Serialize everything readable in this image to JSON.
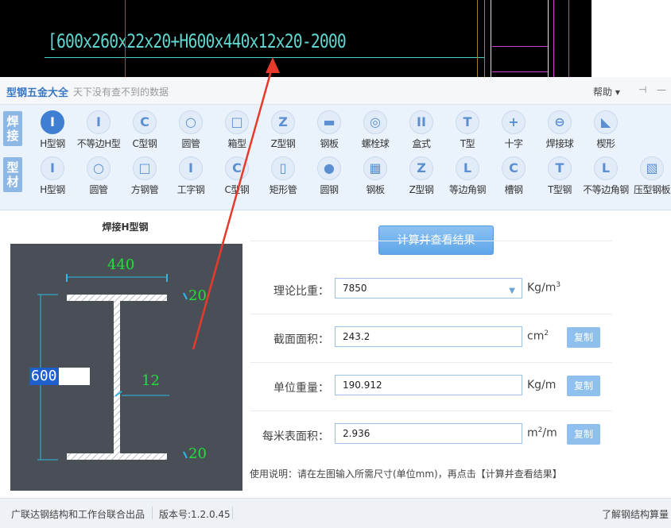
{
  "cad": {
    "text": "[600x260x22x20+H600x440x12x20-2000"
  },
  "app": {
    "title": "型钢五金大全",
    "subtitle": "天下没有查不到的数据",
    "help_label": "帮助 ▾"
  },
  "toolbar": {
    "group1_label": "焊接",
    "group2_label": "型材",
    "row1": [
      {
        "label": "H型钢",
        "icon": "I"
      },
      {
        "label": "不等边H型",
        "icon": "I"
      },
      {
        "label": "C型钢",
        "icon": "C"
      },
      {
        "label": "圆管",
        "icon": "○"
      },
      {
        "label": "箱型",
        "icon": "□"
      },
      {
        "label": "Z型钢",
        "icon": "Z"
      },
      {
        "label": "钢板",
        "icon": "▬"
      },
      {
        "label": "螺栓球",
        "icon": "◎"
      },
      {
        "label": "盒式",
        "icon": "II"
      },
      {
        "label": "T型",
        "icon": "T"
      },
      {
        "label": "十字",
        "icon": "+"
      },
      {
        "label": "焊接球",
        "icon": "⊖"
      },
      {
        "label": "楔形",
        "icon": "◣"
      }
    ],
    "row2": [
      {
        "label": "H型钢",
        "icon": "I"
      },
      {
        "label": "圆管",
        "icon": "○"
      },
      {
        "label": "方钢管",
        "icon": "□"
      },
      {
        "label": "工字钢",
        "icon": "I"
      },
      {
        "label": "C型钢",
        "icon": "C"
      },
      {
        "label": "矩形管",
        "icon": "▯"
      },
      {
        "label": "圆钢",
        "icon": "●"
      },
      {
        "label": "钢板",
        "icon": "▦"
      },
      {
        "label": "Z型钢",
        "icon": "Z"
      },
      {
        "label": "等边角钢",
        "icon": "L"
      },
      {
        "label": "槽钢",
        "icon": "C"
      },
      {
        "label": "T型钢",
        "icon": "T"
      },
      {
        "label": "不等边角钢",
        "icon": "L"
      },
      {
        "label": "压型钢板",
        "icon": "▧"
      }
    ]
  },
  "panel": {
    "section_title": "焊接H型钢",
    "dims": {
      "width": "440",
      "top_flange": "20",
      "web": "12",
      "bottom_flange": "20",
      "height": "600"
    },
    "calc_button": "计算并查看结果",
    "density": {
      "label": "理论比重：",
      "value": "7850",
      "unit": "Kg/m",
      "unit_sup": "3"
    },
    "area": {
      "label": "截面面积：",
      "value": "243.2",
      "unit": "cm",
      "unit_sup": "2",
      "copy": "复制"
    },
    "weight": {
      "label": "单位重量：",
      "value": "190.912",
      "unit": "Kg/m",
      "copy": "复制"
    },
    "surface": {
      "label": "每米表面积：",
      "value": "2.936",
      "unit": "m",
      "unit_sup": "2",
      "unit_tail": "/m",
      "copy": "复制"
    },
    "usage": "使用说明：请在左图输入所需尺寸(单位mm)，再点击【计算并查看结果】"
  },
  "status": {
    "org": "广联达钢结构和工作台联合出品",
    "version": "版本号:1.2.0.45",
    "link": "了解钢结构算量"
  },
  "colors": {
    "accent": "#3f7fd3",
    "cad_text": "#5fd6d0",
    "dim_text": "#22e03a",
    "arrow": "#e83a2a"
  }
}
